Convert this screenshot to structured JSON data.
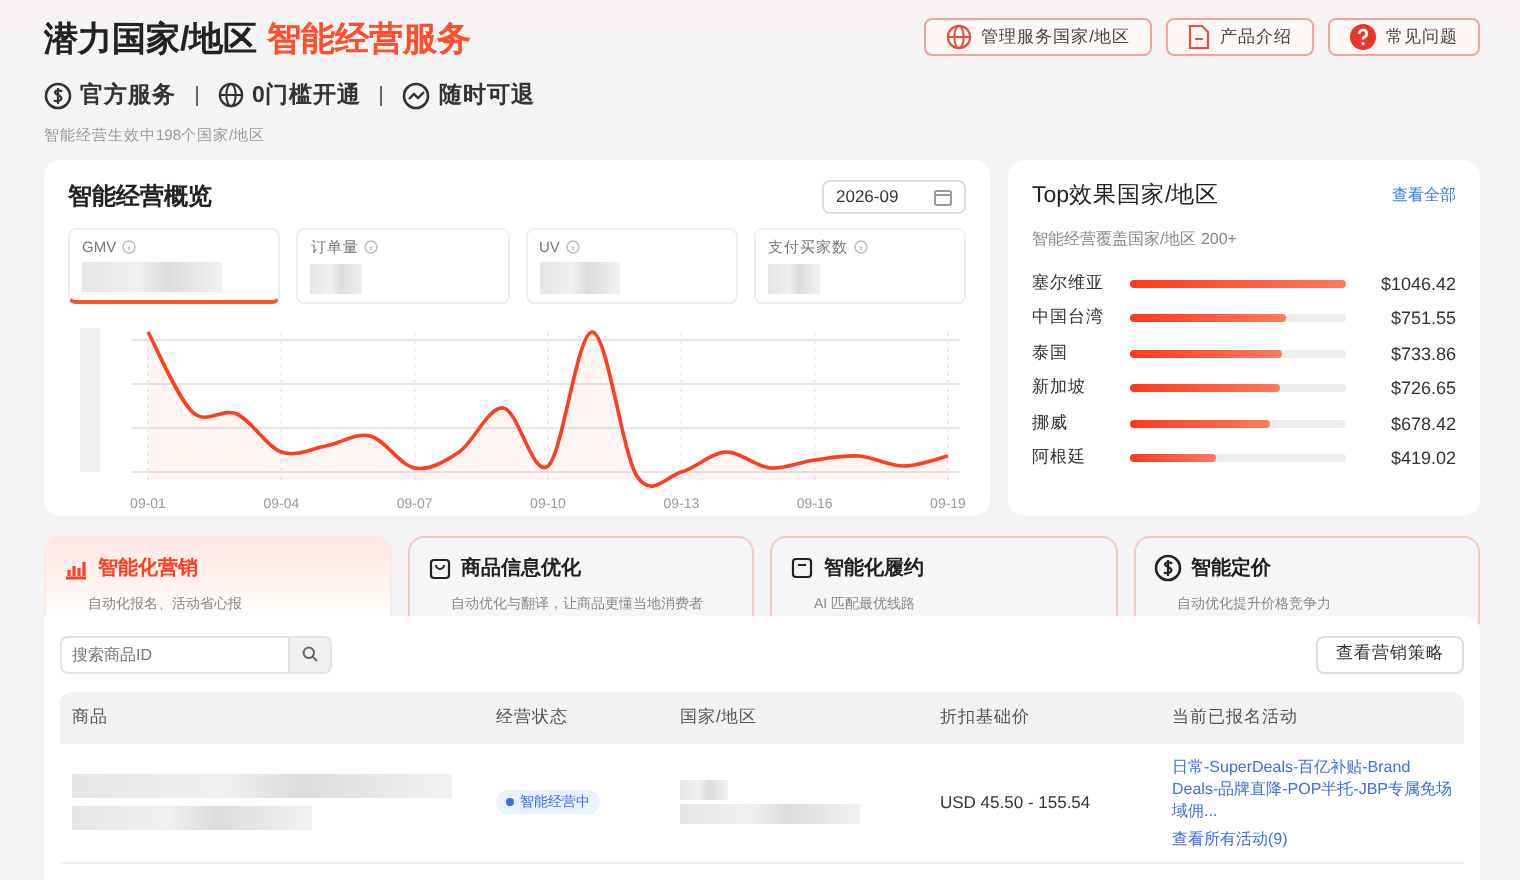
{
  "header": {
    "title": "潜力国家/地区",
    "title_accent": "智能经营服务",
    "features": [
      {
        "kind": "dollar",
        "label": "官方服务"
      },
      {
        "kind": "globe",
        "label": "0门槛开通"
      },
      {
        "kind": "trend",
        "label": "随时可退"
      }
    ],
    "note": "智能经营生效中198个国家/地区",
    "buttons": [
      {
        "kind": "globe",
        "label": "管理服务国家/地区"
      },
      {
        "kind": "doc",
        "label": "产品介绍"
      },
      {
        "kind": "help",
        "label": "常见问题"
      }
    ]
  },
  "overview": {
    "title": "智能经营概览",
    "month": "2026-09",
    "metrics": [
      {
        "label": "GMV",
        "selected": true
      },
      {
        "label": "订单量",
        "selected": false
      },
      {
        "label": "UV",
        "selected": false
      },
      {
        "label": "支付买家数",
        "selected": false
      }
    ],
    "x_labels": [
      "09-01",
      "09-04",
      "09-07",
      "09-10",
      "09-13",
      "09-16",
      "09-19"
    ]
  },
  "top": {
    "title": "Top效果国家/地区",
    "link": "查看全部",
    "subtitle": "智能经营覆盖国家/地区 200+",
    "rows": [
      {
        "name": "塞尔维亚",
        "level": 1.0,
        "value": "$1046.42"
      },
      {
        "name": "中国台湾",
        "level": 0.72,
        "value": "$751.55"
      },
      {
        "name": "泰国",
        "level": 0.7,
        "value": "$733.86"
      },
      {
        "name": "新加坡",
        "level": 0.69,
        "value": "$726.65"
      },
      {
        "name": "挪威",
        "level": 0.65,
        "value": "$678.42"
      },
      {
        "name": "阿根廷",
        "level": 0.4,
        "value": "$419.02"
      }
    ]
  },
  "tabs": [
    {
      "kind": "chart",
      "title": "智能化营销",
      "desc": "自动化报名、活动省心报",
      "selected": true
    },
    {
      "kind": "bag",
      "title": "商品信息优化",
      "desc": "自动优化与翻译，让商品更懂当地消费者",
      "selected": false
    },
    {
      "kind": "box",
      "title": "智能化履约",
      "desc": "AI 匹配最优线路",
      "selected": false
    },
    {
      "kind": "dollar",
      "title": "智能定价",
      "desc": "自动优化提升价格竞争力",
      "selected": false
    }
  ],
  "table": {
    "search": {
      "placeholder": "搜索商品ID"
    },
    "strategy_button": "查看营销策略",
    "columns": [
      "商品",
      "经营状态",
      "国家/地区",
      "折扣基础价",
      "当前已报名活动"
    ],
    "rows": [
      {
        "status": "智能经营中",
        "price": "USD 45.50 - 155.54",
        "activities": "日常-SuperDeals-百亿补贴-Brand Deals-品牌直降-POP半托-JBP专属免场域佣...",
        "more": "查看所有活动(9)"
      }
    ]
  }
}
